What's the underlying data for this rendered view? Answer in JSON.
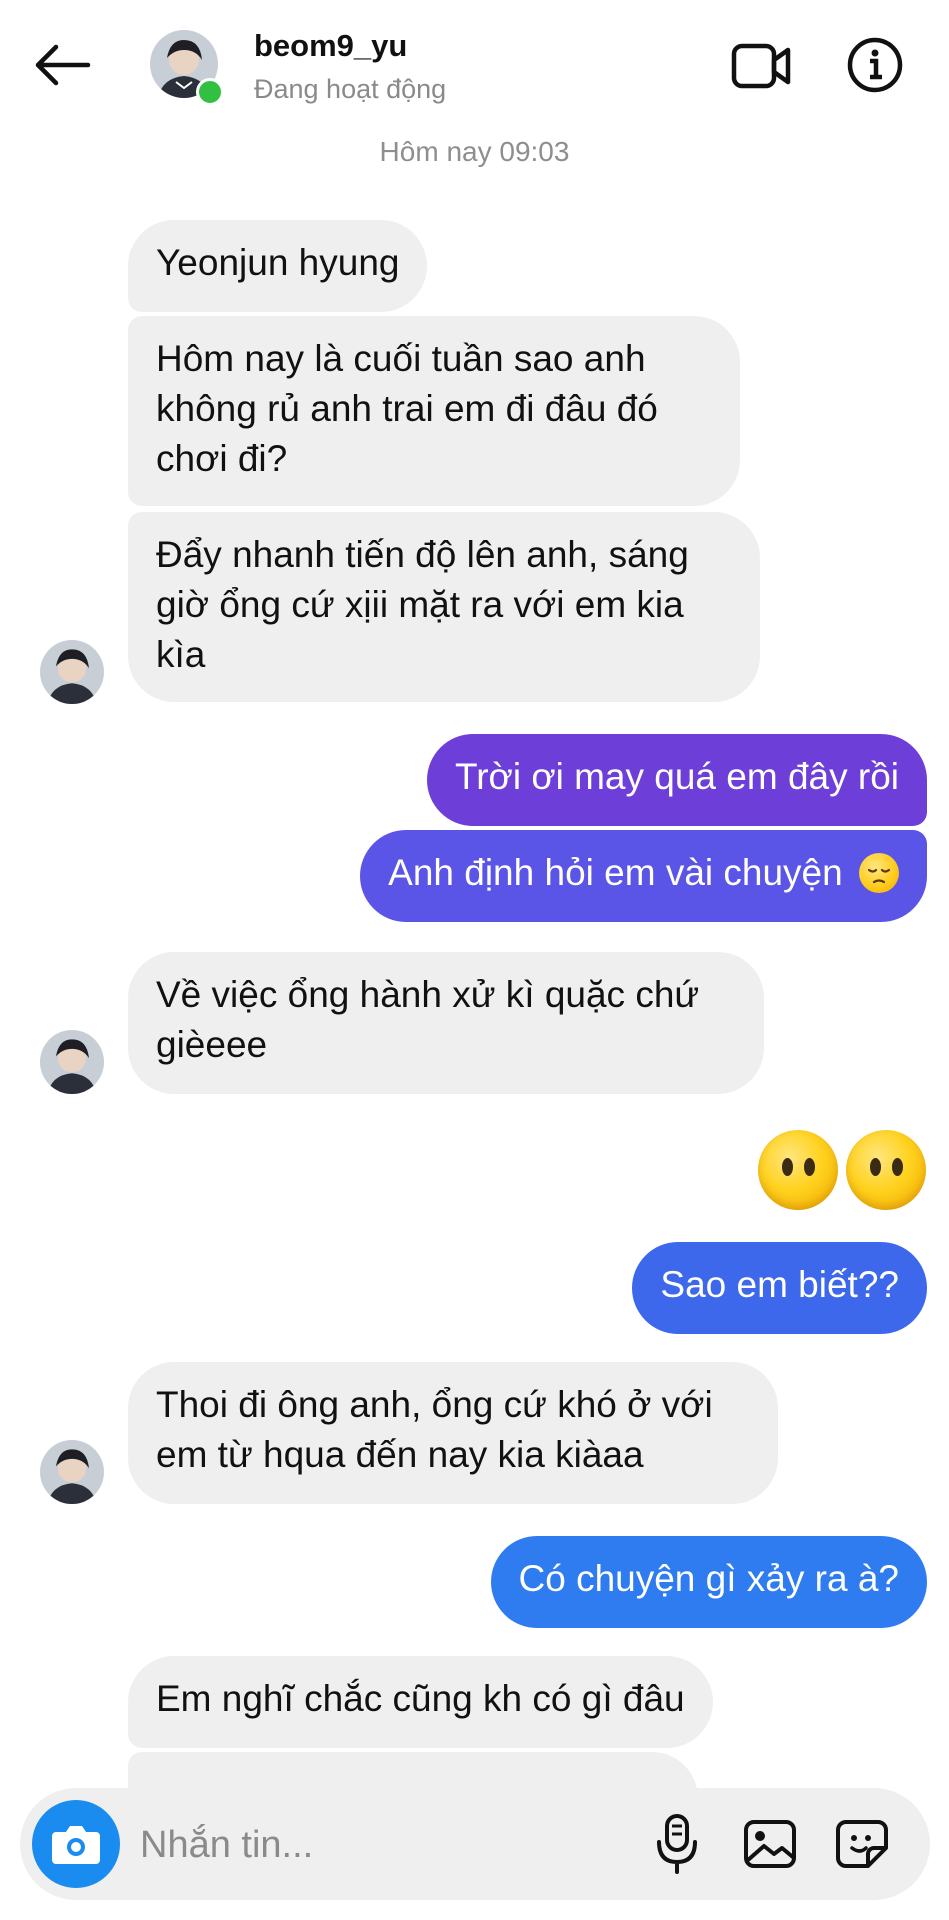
{
  "header": {
    "username": "beom9_yu",
    "status": "Đang hoạt động",
    "back_icon": "arrow-left-icon",
    "video_icon": "video-call-icon",
    "info_icon": "info-icon"
  },
  "timestamp": "Hôm nay 09:03",
  "messages": [
    {
      "sender": "them",
      "text": "Yeonjun hyung"
    },
    {
      "sender": "them",
      "lines": [
        "Hôm nay là cuối tuần sao anh",
        "không rủ anh trai em đi đâu đó",
        "chơi đi?"
      ]
    },
    {
      "sender": "them",
      "lines": [
        "Đẩy nhanh tiến độ lên anh, sáng",
        "giờ ổng cứ xịii mặt ra với em kia",
        "kìa"
      ]
    },
    {
      "sender": "me",
      "text": "Trời ơi may quá em đây rồi"
    },
    {
      "sender": "me",
      "text": "Anh định hỏi em vài chuyện",
      "emoji": "pensive-face"
    },
    {
      "sender": "them",
      "lines": [
        "Về việc ổng hành xử kì quặc chứ",
        "gièeee"
      ]
    },
    {
      "sender": "me",
      "emoji": "face-without-mouth",
      "count": 2
    },
    {
      "sender": "me",
      "text": "Sao em biết??"
    },
    {
      "sender": "them",
      "lines": [
        "Thoi đi ông anh, ổng cứ khó ở với",
        "em từ hqua đến nay kia kiàaa"
      ]
    },
    {
      "sender": "me",
      "text": "Có chuyện gì xảy ra à?"
    },
    {
      "sender": "them",
      "text": "Em nghĩ chắc cũng kh có gì đâu"
    }
  ],
  "composer": {
    "placeholder": "Nhắn tin...",
    "camera_icon": "camera-icon",
    "mic_icon": "microphone-icon",
    "gallery_icon": "gallery-icon",
    "sticker_icon": "sticker-icon"
  },
  "colors": {
    "incoming_bubble": "#efefef",
    "outgoing_purple": "#6e3fd8",
    "outgoing_blue": "#2f7cf0",
    "online": "#31c041",
    "camera_button": "#1a8cf0"
  }
}
